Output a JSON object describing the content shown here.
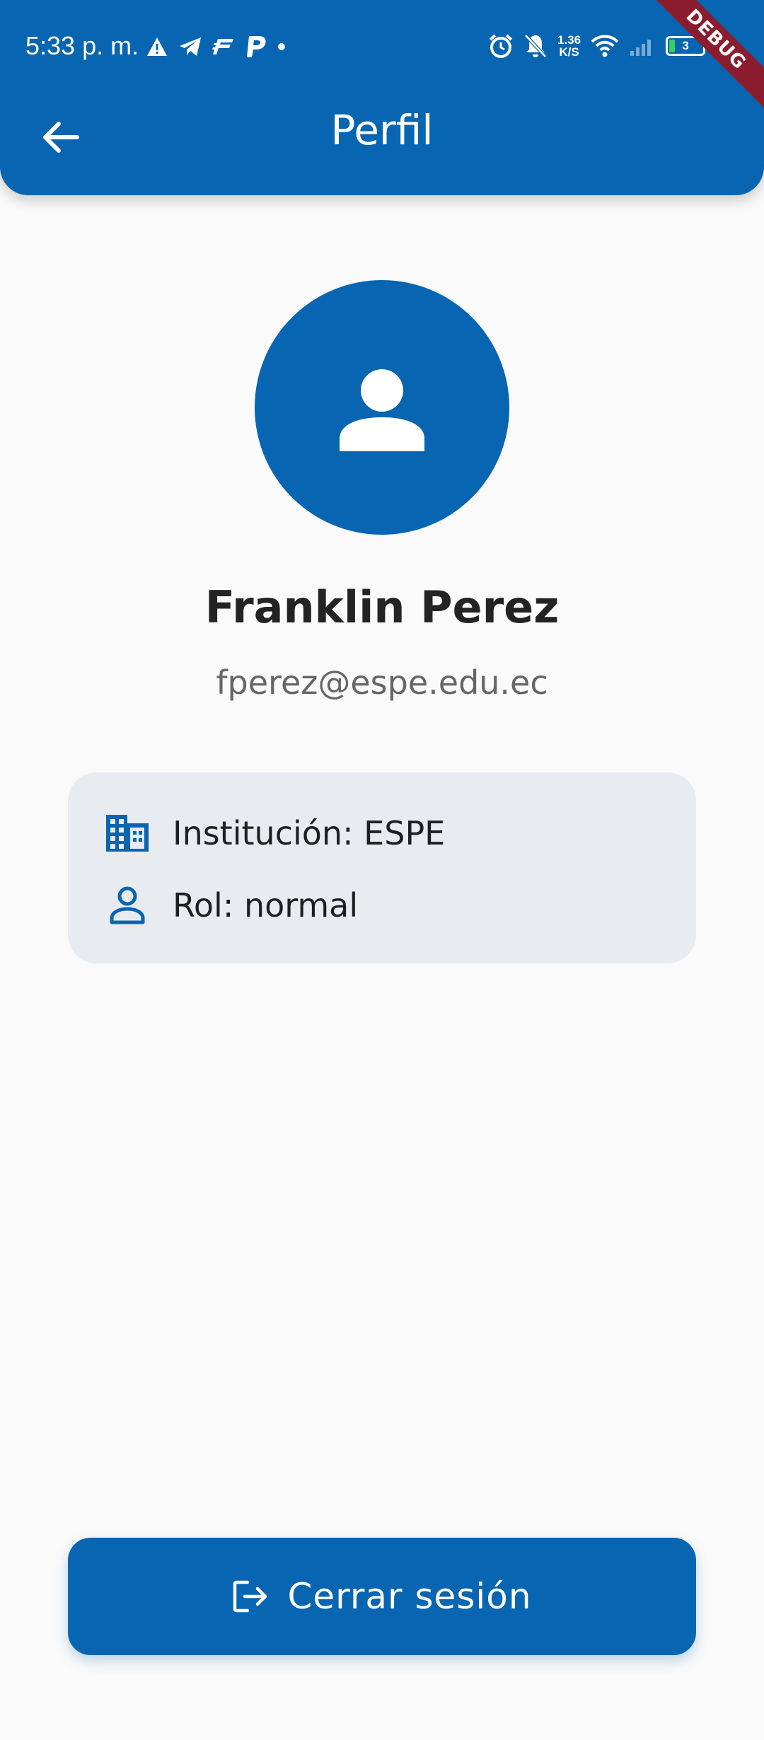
{
  "status_bar": {
    "time": "5:33 p. m.",
    "net_speed_value": "1.36",
    "net_speed_unit": "K/S",
    "battery": "3",
    "debug_label": "DEBUG"
  },
  "header": {
    "title": "Perfil"
  },
  "profile": {
    "name": "Franklin Perez",
    "email": "fperez@espe.edu.ec"
  },
  "info": {
    "institution": "Institución: ESPE",
    "role": "Rol: normal"
  },
  "actions": {
    "logout_label": "Cerrar sesión"
  },
  "colors": {
    "primary": "#0865b1",
    "card_bg": "#e8ecf1",
    "page_bg": "#fafafa"
  }
}
